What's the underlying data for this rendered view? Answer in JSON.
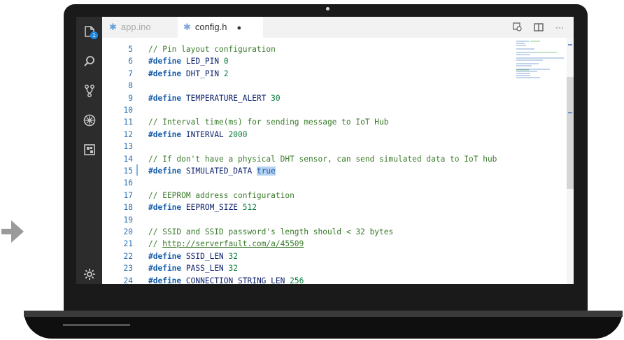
{
  "tabs": [
    {
      "icon": "✱",
      "label": "app.ino",
      "active": false
    },
    {
      "icon": "✱",
      "label": "config.h",
      "active": true,
      "dirty": "●"
    }
  ],
  "activity_badge": "1",
  "toolbar_icons": [
    "open-preview-icon",
    "split-editor-icon",
    "more-actions-icon"
  ],
  "toolbar_more": "···",
  "code_lines": [
    {
      "n": "5",
      "text": "// Pin layout configuration"
    },
    {
      "n": "6",
      "text": "#define LED_PIN 0"
    },
    {
      "n": "7",
      "text": "#define DHT_PIN 2"
    },
    {
      "n": "8",
      "text": ""
    },
    {
      "n": "9",
      "text": "#define TEMPERATURE_ALERT 30"
    },
    {
      "n": "10",
      "text": ""
    },
    {
      "n": "11",
      "text": "// Interval time(ms) for sending message to IoT Hub"
    },
    {
      "n": "12",
      "text": "#define INTERVAL 2000"
    },
    {
      "n": "13",
      "text": ""
    },
    {
      "n": "14",
      "text": "// If don't have a physical DHT sensor, can send simulated data to IoT hub"
    },
    {
      "n": "15",
      "text": "#define SIMULATED_DATA true"
    },
    {
      "n": "16",
      "text": ""
    },
    {
      "n": "17",
      "text": "// EEPROM address configuration"
    },
    {
      "n": "18",
      "text": "#define EEPROM_SIZE 512"
    },
    {
      "n": "19",
      "text": ""
    },
    {
      "n": "20",
      "text": "// SSID and SSID password's length should < 32 bytes"
    },
    {
      "n": "21",
      "text": "// http://serverfault.com/a/45509"
    },
    {
      "n": "22",
      "text": "#define SSID_LEN 32"
    },
    {
      "n": "23",
      "text": "#define PASS_LEN 32"
    },
    {
      "n": "24",
      "text": "#define CONNECTION_STRING_LEN 256"
    }
  ],
  "colors": {
    "selection": "#b7d3f2",
    "comment": "#3a7a2a",
    "keyword": "#1a5ea8"
  }
}
